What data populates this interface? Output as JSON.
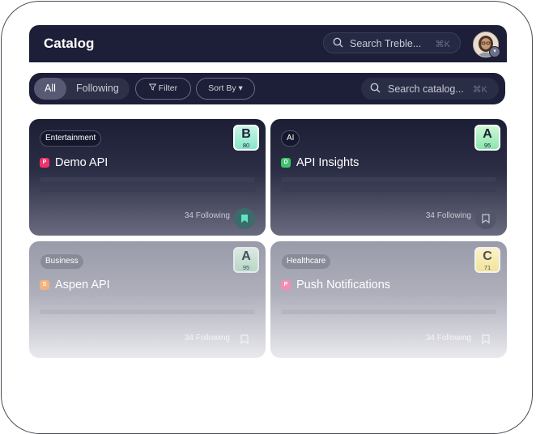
{
  "header": {
    "title": "Catalog",
    "search_placeholder": "Search Treble...",
    "search_shortcut": "⌘K"
  },
  "toolbar": {
    "segments": {
      "all": "All",
      "following": "Following",
      "active": "All"
    },
    "filter_label": "Filter",
    "sort_label": "Sort By",
    "search_placeholder": "Search catalog...",
    "search_shortcut": "⌘K"
  },
  "cards": [
    {
      "category": "Entertainment",
      "grade": "B",
      "score": "80",
      "icon_letter": "P",
      "icon_color": "#f0336a",
      "name": "Demo API",
      "following": "34 Following",
      "bookmarked": true
    },
    {
      "category": "AI",
      "grade": "A",
      "score": "95",
      "icon_letter": "D",
      "icon_color": "#3ec46d",
      "name": "API Insights",
      "following": "34 Following",
      "bookmarked": false
    },
    {
      "category": "Business",
      "grade": "A",
      "score": "95",
      "icon_letter": "S",
      "icon_color": "#f5b27c",
      "name": "Aspen API",
      "following": "34 Following",
      "bookmarked": false
    },
    {
      "category": "Healthcare",
      "grade": "C",
      "score": "71",
      "icon_letter": "P",
      "icon_color": "#f48db3",
      "name": "Push Notifications",
      "following": "34 Following",
      "bookmarked": false
    }
  ],
  "colors": {
    "navy": "#1d1f38",
    "bookmark_active": "#3c6b6c"
  }
}
